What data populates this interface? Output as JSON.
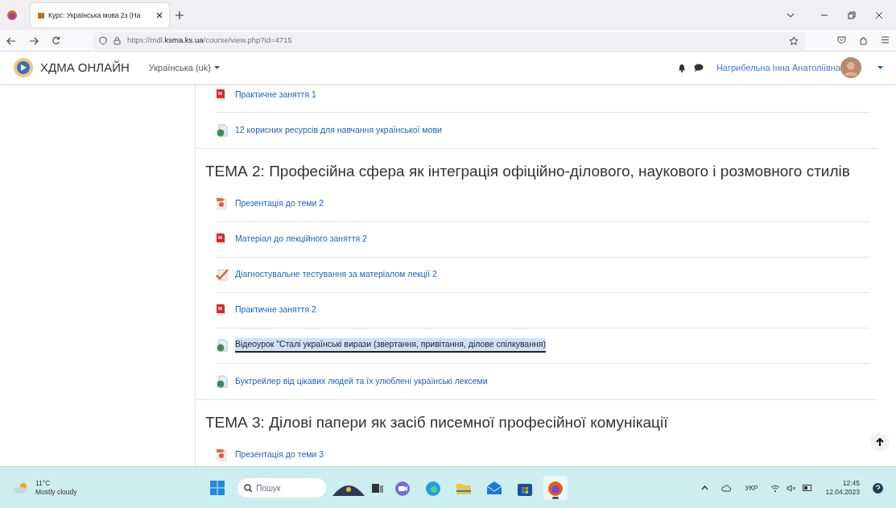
{
  "browser": {
    "tab": {
      "title": "Курс: Українська мова 2з (На",
      "selected": true
    },
    "url": {
      "prefix": "https://mdl.",
      "domain": "ksma.ks.ua",
      "path": "/course/view.php?id=4715"
    }
  },
  "navbar": {
    "site_name": "ХДМА ОНЛАЙН",
    "language": "Українська (uk)",
    "user_name": "Нагрибельна Інна Анатоліївна"
  },
  "sections": [
    {
      "activities": [
        {
          "kind": "pdf",
          "label": "Практичне заняття 1",
          "highlighted": false
        },
        {
          "kind": "url",
          "label": "12 корисних ресурсів для навчання української мови",
          "highlighted": false
        }
      ]
    },
    {
      "title": "ТЕМА 2: Професійна сфера як інтеграція офіційно-ділового, наукового і розмовного стилів",
      "activities": [
        {
          "kind": "presentation",
          "label": "Презентація до теми 2",
          "highlighted": false
        },
        {
          "kind": "pdf",
          "label": "Матеріал до лекційного заняття 2",
          "highlighted": false
        },
        {
          "kind": "quiz",
          "label": "Діагностувальне тестування за матеріалом лекції 2",
          "highlighted": false
        },
        {
          "kind": "pdf",
          "label": "Практичне заняття 2",
          "highlighted": false
        },
        {
          "kind": "url",
          "label": "Відеоурок \"Сталі українські вирази (звертання, привітання, ділове спілкування)",
          "highlighted": true
        },
        {
          "kind": "url",
          "label": "Буктрейлер від цікавих людей та їх улюблені українські лексеми",
          "highlighted": false
        }
      ]
    },
    {
      "title": "ТЕМА 3: Ділові папери як засіб писемної професійної комунікації",
      "activities": [
        {
          "kind": "presentation",
          "label": "Презентація до теми 3",
          "highlighted": false
        }
      ]
    }
  ],
  "taskbar": {
    "weather": {
      "temperature": "11°C",
      "condition": "Mostly cloudy"
    },
    "search": {
      "placeholder": "Пошук"
    },
    "apps": [
      {
        "kind": "chat",
        "selected": false
      },
      {
        "kind": "edge",
        "selected": false
      },
      {
        "kind": "folder",
        "selected": false
      },
      {
        "kind": "mail",
        "selected": false
      },
      {
        "kind": "store",
        "selected": false
      },
      {
        "kind": "firefox",
        "selected": true
      }
    ],
    "language": "УКР",
    "time": "12:45",
    "date": "12.04.2023"
  }
}
